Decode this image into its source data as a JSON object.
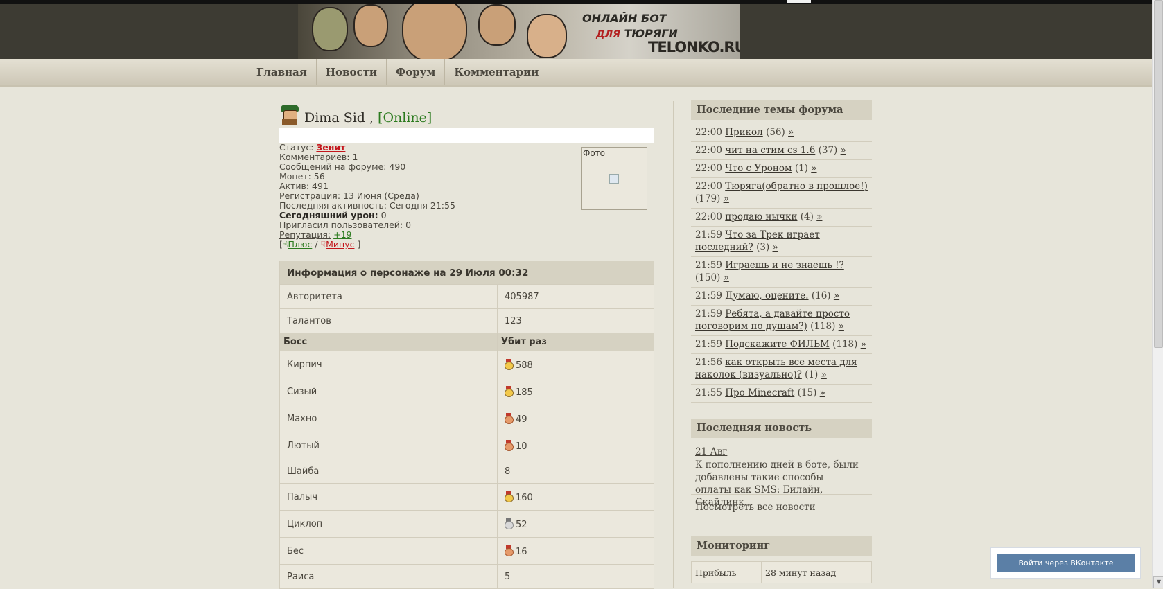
{
  "header": {
    "banner_line1": "ОНЛАЙН БОТ",
    "banner_line2_prefix": "ДЛЯ",
    "banner_line2": "ТЮРЯГИ",
    "banner_site": "TELONKO.RU"
  },
  "nav": {
    "items": [
      {
        "label": "Главная"
      },
      {
        "label": "Новости"
      },
      {
        "label": "Форум"
      },
      {
        "label": "Комментарии"
      }
    ]
  },
  "profile": {
    "name": "Dima Sid ,",
    "online": "[Online]",
    "status_label": "Статус:",
    "status_value": "Зенит",
    "comments": "Комментариев: 1",
    "forum_posts": "Сообщений на форуме: 490",
    "coins": "Монет: 56",
    "activity": "Актив: 491",
    "registration": "Регистрация: 13 Июня (Среда)",
    "last_activity": "Последняя активность: Сегодня 21:55",
    "damage_label": "Сегодняшний урон:",
    "damage_value": "0",
    "invited": "Пригласил пользователей: 0",
    "reputation_label": "Репутация:",
    "reputation_value": "+19",
    "plus_label": "Плюс",
    "minus_label": "Минус",
    "photo_label": "Фото"
  },
  "character": {
    "caption": "Информация о персонаже на 29 Июля 00:32",
    "stats": [
      {
        "name": "Авторитета",
        "value": "405987"
      },
      {
        "name": "Талантов",
        "value": "123"
      }
    ],
    "boss_header": "Босс",
    "kills_header": "Убит раз",
    "bosses": [
      {
        "name": "Кирпич",
        "kills": "588",
        "medal": "gold"
      },
      {
        "name": "Сизый",
        "kills": "185",
        "medal": "gold"
      },
      {
        "name": "Махно",
        "kills": "49",
        "medal": "bronze"
      },
      {
        "name": "Лютый",
        "kills": "10",
        "medal": "bronze"
      },
      {
        "name": "Шайба",
        "kills": "8",
        "medal": "none"
      },
      {
        "name": "Палыч",
        "kills": "160",
        "medal": "gold"
      },
      {
        "name": "Циклоп",
        "kills": "52",
        "medal": "silver"
      },
      {
        "name": "Бес",
        "kills": "16",
        "medal": "bronze"
      },
      {
        "name": "Раиса",
        "kills": "5",
        "medal": "none"
      }
    ]
  },
  "sidebar": {
    "forum_title": "Последние темы форума",
    "forum_topics": [
      {
        "time": "22:00",
        "title": "Прикол",
        "count": "(56)"
      },
      {
        "time": "22:00",
        "title": "чит на стим cs 1.6",
        "count": "(37)"
      },
      {
        "time": "22:00",
        "title": "Что с Уроном",
        "count": "(1)"
      },
      {
        "time": "22:00",
        "title": "Тюряга(обратно в прошлое!)",
        "count": "(179)"
      },
      {
        "time": "22:00",
        "title": "продаю нычки",
        "count": "(4)"
      },
      {
        "time": "21:59",
        "title": "Что за Трек играет последний?",
        "count": "(3)"
      },
      {
        "time": "21:59",
        "title": "Играешь и не знаешь !?",
        "count": "(150)"
      },
      {
        "time": "21:59",
        "title": "Думаю, оцените.",
        "count": "(16)"
      },
      {
        "time": "21:59",
        "title": "Ребята, а давайте просто поговорим по душам?)",
        "count": "(118)"
      },
      {
        "time": "21:59",
        "title": "Подскажите ФИЛЬМ",
        "count": "(118)"
      },
      {
        "time": "21:56",
        "title": "как открыть все места для наколок (визуально)?",
        "count": "(1)"
      },
      {
        "time": "21:55",
        "title": "Про Minecraft",
        "count": "(15)"
      }
    ],
    "arrow": "»",
    "news_title": "Последняя новость",
    "news_date": "21 Авг",
    "news_text": "К пополнению дней в боте, были добавлены такие способы оплаты как SMS: Билайн, Скайлинк...",
    "news_all": "Посмотреть все новости",
    "monitoring_title": "Мониторинг",
    "monitoring": [
      {
        "label": "Прибыль",
        "value": "28 минут назад"
      }
    ]
  },
  "vk": {
    "button": "Войти через ВКонтакте"
  }
}
